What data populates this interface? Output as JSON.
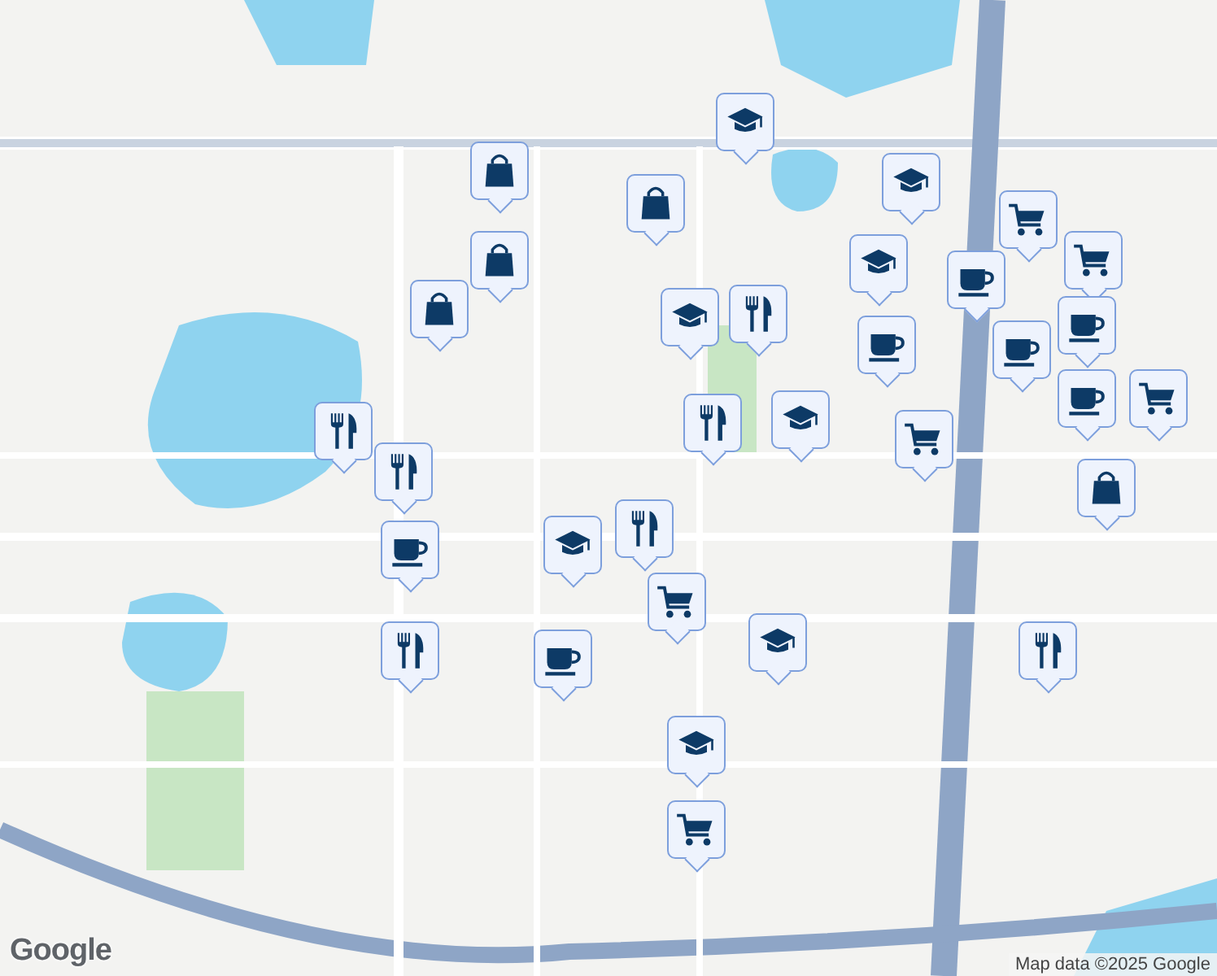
{
  "markers": [
    {
      "kind": "school"
    },
    {
      "kind": "bag"
    },
    {
      "kind": "bag"
    },
    {
      "kind": "school"
    },
    {
      "kind": "school"
    },
    {
      "kind": "cart"
    },
    {
      "kind": "cart"
    },
    {
      "kind": "bag"
    },
    {
      "kind": "bag"
    },
    {
      "kind": "school"
    },
    {
      "kind": "restaurant"
    },
    {
      "kind": "cafe"
    },
    {
      "kind": "cafe"
    },
    {
      "kind": "cafe"
    },
    {
      "kind": "cafe"
    },
    {
      "kind": "cafe"
    },
    {
      "kind": "cart"
    },
    {
      "kind": "restaurant"
    },
    {
      "kind": "school"
    },
    {
      "kind": "cart"
    },
    {
      "kind": "restaurant"
    },
    {
      "kind": "restaurant"
    },
    {
      "kind": "cafe"
    },
    {
      "kind": "bag"
    },
    {
      "kind": "school"
    },
    {
      "kind": "restaurant"
    },
    {
      "kind": "cart"
    },
    {
      "kind": "school"
    },
    {
      "kind": "restaurant"
    },
    {
      "kind": "restaurant"
    },
    {
      "kind": "cafe"
    },
    {
      "kind": "school"
    },
    {
      "kind": "cart"
    }
  ],
  "logo": "Google",
  "attribution": "Map data ©2025 Google"
}
